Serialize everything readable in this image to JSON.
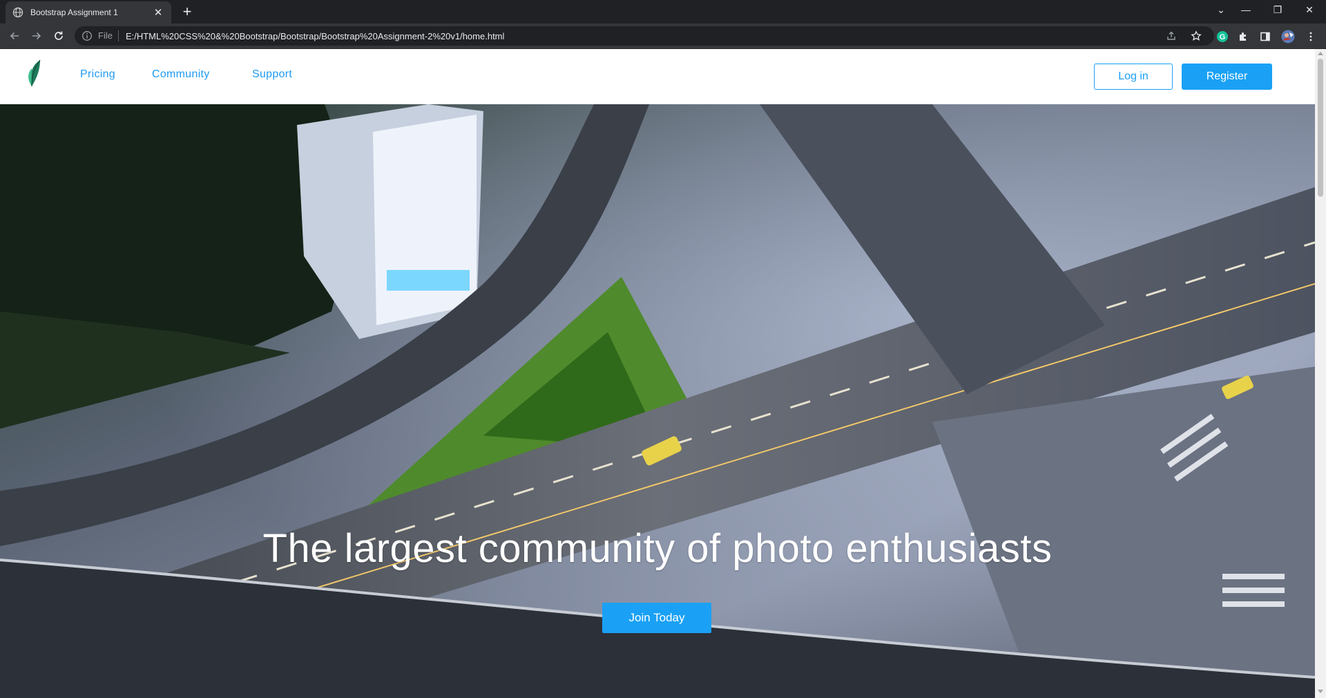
{
  "browser": {
    "tab_title": "Bootstrap Assignment 1",
    "tab_close": "✕",
    "new_tab": "+",
    "file_label": "File",
    "url": "E:/HTML%20CSS%20&%20Bootstrap/Bootstrap/Bootstrap%20Assignment-2%20v1/home.html",
    "window_controls": {
      "dropdown": "⌄",
      "minimize": "—",
      "restore": "❐",
      "close": "✕"
    }
  },
  "navbar": {
    "links": [
      "Pricing",
      "Community",
      "Support"
    ],
    "login_label": "Log in",
    "register_label": "Register"
  },
  "hero": {
    "headline": "The largest community of photo enthusiasts",
    "cta_label": "Join Today"
  },
  "colors": {
    "accent": "#1aa1f5",
    "link": "#1e9bf0",
    "browser_bg": "#202124",
    "toolbar_bg": "#35363a"
  },
  "icons": [
    "globe-icon",
    "back-arrow-icon",
    "forward-arrow-icon",
    "reload-icon",
    "info-icon",
    "share-icon",
    "star-icon",
    "grammarly-icon",
    "puzzle-icon",
    "side-panel-icon",
    "profile-avatar",
    "kebab-menu-icon",
    "leaf-logo"
  ]
}
